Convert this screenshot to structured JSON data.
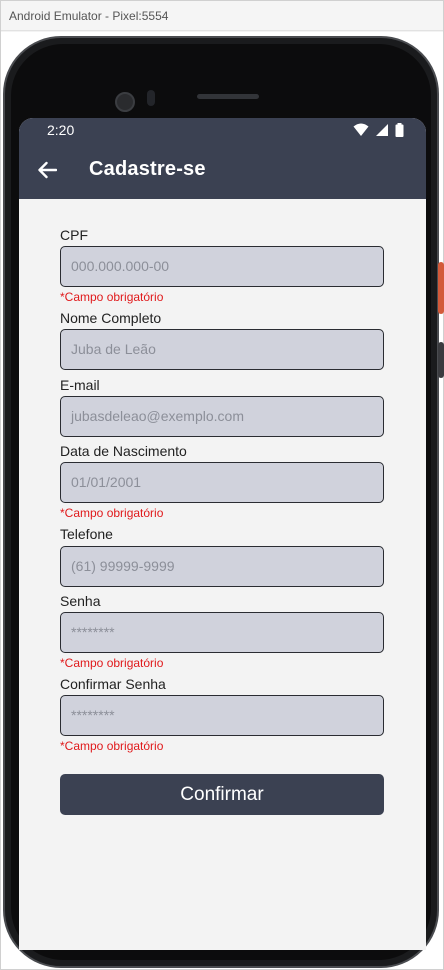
{
  "window": {
    "title": "Android Emulator - Pixel:5554"
  },
  "statusbar": {
    "time": "2:20",
    "icons": [
      "wifi-icon",
      "signal-icon",
      "battery-icon"
    ]
  },
  "appbar": {
    "title": "Cadastre-se",
    "back_icon": "arrow-left-icon"
  },
  "form": {
    "fields": [
      {
        "label": "CPF",
        "placeholder": "000.000.000-00",
        "error": "*Campo obrigatório"
      },
      {
        "label": "Nome Completo",
        "placeholder": "Juba de Leão",
        "error": ""
      },
      {
        "label": "E-mail",
        "placeholder": "jubasdeleao@exemplo.com",
        "error": ""
      },
      {
        "label": "Data de Nascimento",
        "placeholder": "01/01/2001",
        "error": "*Campo obrigatório"
      },
      {
        "label": "Telefone",
        "placeholder": "(61) 99999-9999",
        "error": ""
      },
      {
        "label": "Senha",
        "placeholder": "********",
        "error": "*Campo obrigatório"
      },
      {
        "label": "Confirmar Senha",
        "placeholder": "********",
        "error": "*Campo obrigatório"
      }
    ],
    "submit_label": "Confirmar"
  },
  "colors": {
    "appbar": "#3b4152",
    "input_bg": "#d0d2dc",
    "error": "#e0191b",
    "screen_bg": "#f3f3f3"
  }
}
